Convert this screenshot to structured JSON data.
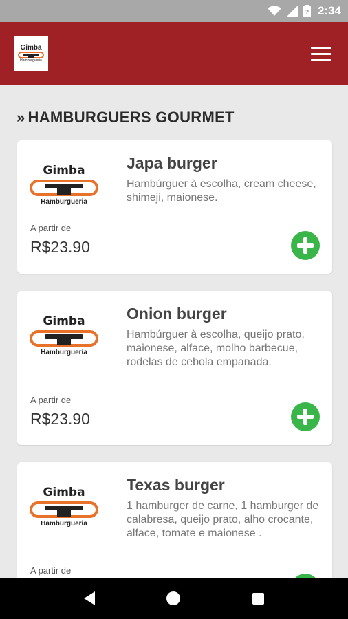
{
  "status_bar": {
    "time": "2:34",
    "icons": [
      "wifi-icon",
      "signal-icon",
      "battery-icon"
    ]
  },
  "app_bar": {
    "logo_name": "Gimba",
    "logo_sub": "Hamburgueria",
    "menu_icon": "hamburger-menu-icon"
  },
  "section": {
    "title": "HAMBURGUERS GOURMET",
    "chevron": "»"
  },
  "products": [
    {
      "brand_name": "Gimba",
      "brand_sub": "Hamburgueria",
      "name": "Japa burger",
      "description": "Hambúrguer à escolha, cream cheese, shimeji, maionese.",
      "from_label": "A partir de",
      "price": "R$23.90"
    },
    {
      "brand_name": "Gimba",
      "brand_sub": "Hamburgueria",
      "name": "Onion burger",
      "description": "Hambúrguer à escolha, queijo prato, maionese, alface, molho barbecue, rodelas de cebola empanada.",
      "from_label": "A partir de",
      "price": "R$23.90"
    },
    {
      "brand_name": "Gimba",
      "brand_sub": "Hamburgueria",
      "name": "Texas burger",
      "description": "1 hamburger de carne, 1 hamburger de calabresa, queijo prato, alho crocante, alface, tomate e maionese .",
      "from_label": "A partir de",
      "price": ""
    }
  ],
  "colors": {
    "app_bar": "#a02125",
    "add_button": "#39b54a",
    "logo_orange": "#e8722a"
  },
  "nav_bar": {
    "icons": [
      "back-icon",
      "home-icon",
      "recents-icon"
    ]
  }
}
